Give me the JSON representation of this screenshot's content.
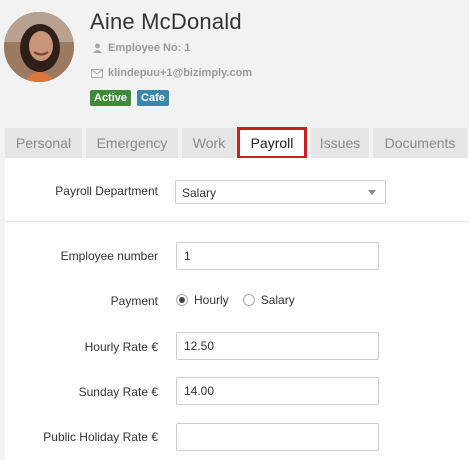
{
  "profile": {
    "name": "Aine McDonald",
    "employee_no_label": "Employee No: 1",
    "email": "klindepuu+1@bizimply.com",
    "badges": [
      {
        "label": "Active",
        "color": "#3d8b37"
      },
      {
        "label": "Cafe",
        "color": "#3a87ad"
      }
    ],
    "icons": {
      "employee": "user-icon",
      "email": "envelope-icon"
    }
  },
  "tabs": [
    {
      "label": "Personal",
      "selected": false
    },
    {
      "label": "Emergency",
      "selected": false
    },
    {
      "label": "Work",
      "selected": false
    },
    {
      "label": "Payroll",
      "selected": true
    },
    {
      "label": "Issues",
      "selected": false
    },
    {
      "label": "Documents",
      "selected": false
    }
  ],
  "form": {
    "payroll_department": {
      "label": "Payroll Department",
      "value": "Salary"
    },
    "employee_number": {
      "label": "Employee number",
      "value": "1"
    },
    "payment": {
      "label": "Payment",
      "options": [
        "Hourly",
        "Salary"
      ],
      "selected": "Hourly"
    },
    "hourly_rate": {
      "label": "Hourly Rate €",
      "value": "12.50"
    },
    "sunday_rate": {
      "label": "Sunday Rate €",
      "value": "14.00"
    },
    "public_holiday_rate": {
      "label": "Public Holiday Rate €",
      "value": ""
    }
  },
  "colors": {
    "highlight_border": "#cc1f1f",
    "active_badge": "#3d8b37",
    "cafe_badge": "#3a87ad"
  }
}
